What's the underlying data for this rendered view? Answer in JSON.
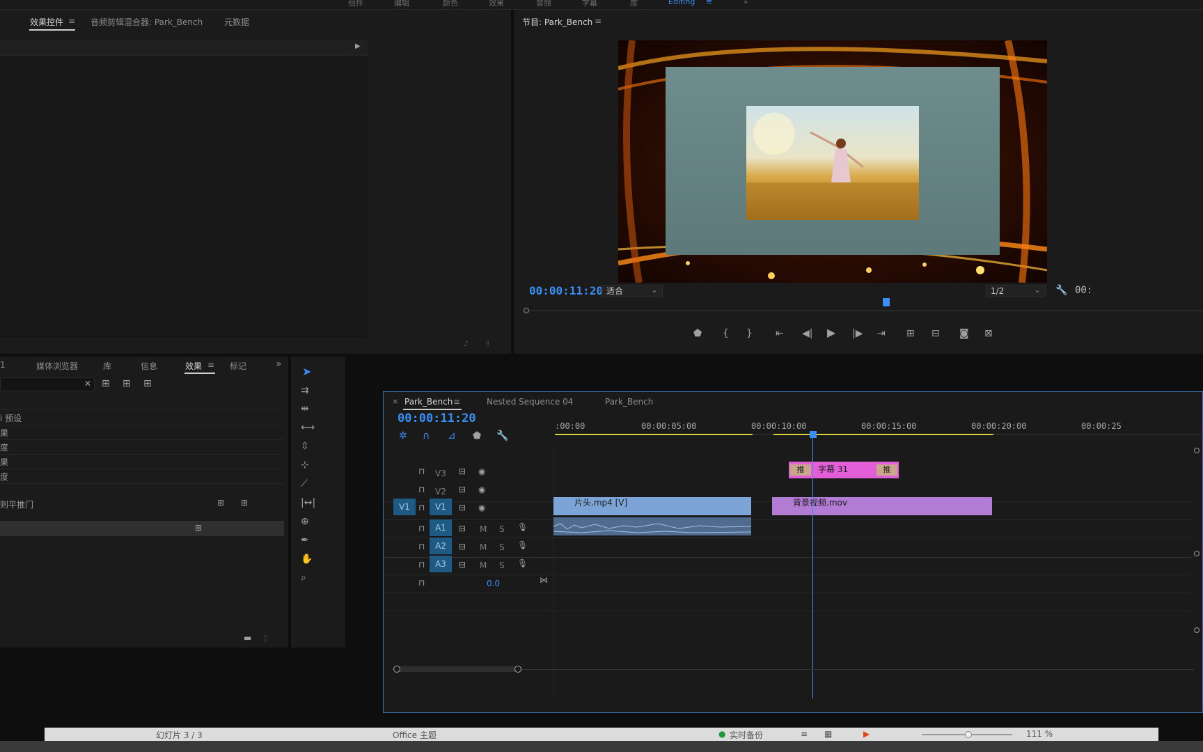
{
  "workspace_tabs": [
    "组件",
    "编辑",
    "颜色",
    "效果",
    "音频",
    "字幕",
    "库",
    "Editing"
  ],
  "workspace_active": "Editing",
  "source_panel": {
    "tabs": [
      "效果控件",
      "音频剪辑混合器: Park_Bench",
      "元数据"
    ],
    "active_tab": "效果控件"
  },
  "program_monitor": {
    "title": "节目: Park_Bench",
    "timecode": "00:00:11:20",
    "fit": "适合",
    "resolution": "1/2",
    "timecode_right": "00:"
  },
  "project_panel": {
    "tabs": [
      "1",
      "媒体浏览器",
      "库",
      "信息",
      "效果",
      "标记"
    ],
    "active_tab": "效果",
    "list_items": [
      "i 预设",
      "果",
      "度",
      "果",
      "度",
      "则平推门"
    ]
  },
  "timeline": {
    "tabs": [
      "Park_Bench",
      "Nested Sequence 04",
      "Park_Bench"
    ],
    "active_tab": "Park_Bench",
    "timecode": "00:00:11:20",
    "ruler": [
      ":00:00",
      "00:00:05:00",
      "00:00:10:00",
      "00:00:15:00",
      "00:00:20:00",
      "00:00:25"
    ],
    "tracks": {
      "v3": "V3",
      "v2": "V2",
      "v1_src": "V1",
      "v1": "V1",
      "a1": "A1",
      "a2": "A2",
      "a3": "A3",
      "mute": "M",
      "solo": "S"
    },
    "master_volume": "0.0",
    "clips": {
      "title_clip": "字幕 31",
      "push_left": "推",
      "push_right": "推",
      "clip_v1_a": "片头.mp4 [V]",
      "clip_v1_b": "背景视频.mov"
    }
  },
  "status_bar": {
    "slide": "幻灯片 3 / 3",
    "theme": "Office 主题",
    "backup": "实时备份",
    "zoom": "111 %"
  },
  "colors": {
    "accent_blue": "#3b8ef3",
    "title_clip": "#e25fd8",
    "video_clip_a": "#7da4d6",
    "video_clip_b": "#b27bd4",
    "audio_clip": "#5a7aa0"
  }
}
